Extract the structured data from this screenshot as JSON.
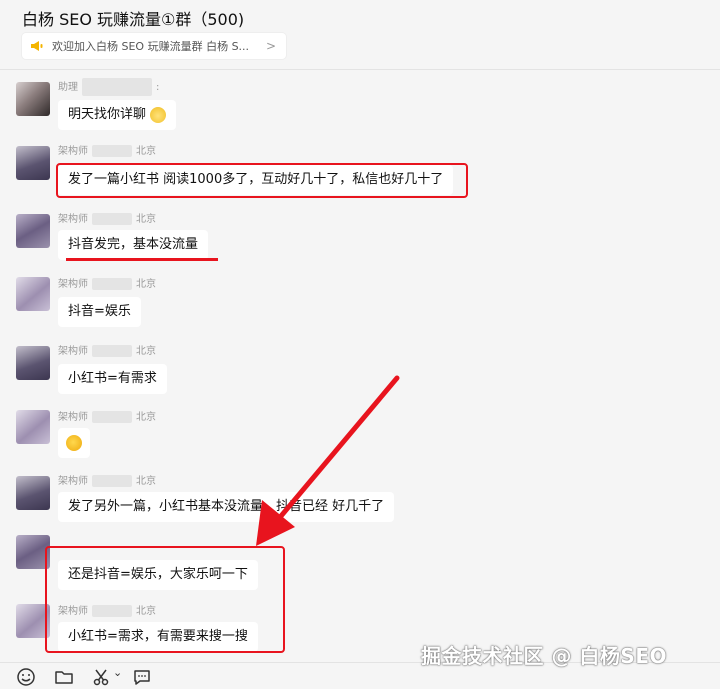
{
  "header": {
    "title": "白杨 SEO 玩赚流量①群（500)",
    "notice": "欢迎加入白杨 SEO 玩赚流量群 白杨 S...",
    "notice_chevron": ">"
  },
  "messages": [
    {
      "sender": "助理",
      "region": "",
      "text": "明天找你详聊",
      "emoji": "cat-face-icon"
    },
    {
      "sender": "架构师",
      "region": "北京",
      "text": "发了一篇小红书 阅读1000多了，互动好几十了，私信也好几十了"
    },
    {
      "sender": "架构师",
      "region": "北京",
      "text": "抖音发完，基本没流量"
    },
    {
      "sender": "架构师",
      "region": "北京",
      "text": "抖音=娱乐"
    },
    {
      "sender": "架构师",
      "region": "北京",
      "text": "小红书=有需求"
    },
    {
      "sender": "架构师",
      "region": "北京",
      "text": "",
      "emoji": "grin-face-icon"
    },
    {
      "sender": "架构师",
      "region": "北京",
      "text": "发了另外一篇，小红书基本没流量，抖音已经 好几千了"
    },
    {
      "sender": "",
      "region": "",
      "text": "还是抖音=娱乐，大家乐呵一下"
    },
    {
      "sender": "架构师",
      "region": "北京",
      "text": "小红书=需求，有需要来搜一搜"
    }
  ],
  "toolbar": {
    "icons": [
      "emoji-icon",
      "folder-icon",
      "scissors-icon",
      "chat-bubble-icon"
    ],
    "scissors_caret": "⌄"
  },
  "watermark": "掘金技术社区 @ 白杨SEO",
  "colors": {
    "highlight": "#e8141e",
    "bubble": "#ffffff",
    "background": "#f5f5f5"
  }
}
